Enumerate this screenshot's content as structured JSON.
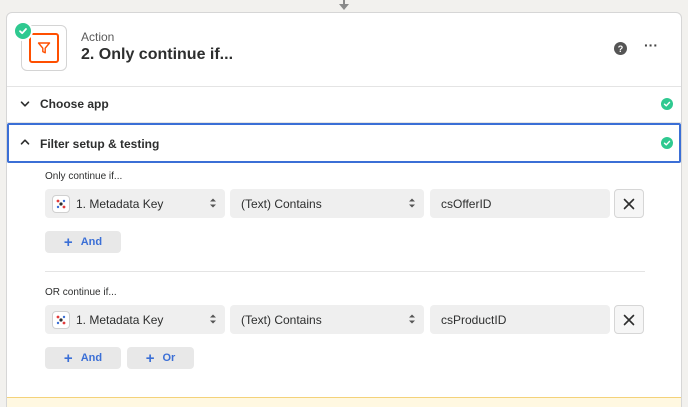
{
  "step": {
    "kicker": "Action",
    "title": "2. Only continue if...",
    "app_icon": "filter-icon",
    "help_glyph": "?",
    "more_glyph": "···"
  },
  "sections": [
    {
      "label": "Choose app",
      "expanded": false,
      "complete": true
    },
    {
      "label": "Filter setup & testing",
      "expanded": true,
      "complete": true
    }
  ],
  "filter_groups": [
    {
      "label": "Only continue if...",
      "conditions": [
        {
          "field": "1. Metadata Key",
          "operator": "(Text) Contains",
          "value": "csOfferID"
        }
      ],
      "buttons": [
        "And"
      ]
    },
    {
      "label": "OR continue if...",
      "conditions": [
        {
          "field": "1. Metadata Key",
          "operator": "(Text) Contains",
          "value": "csProductID"
        }
      ],
      "buttons": [
        "And",
        "Or"
      ]
    }
  ],
  "colors": {
    "accent": "#3b6fd6",
    "success": "#2fc990",
    "brand_orange": "#ff4f00"
  }
}
